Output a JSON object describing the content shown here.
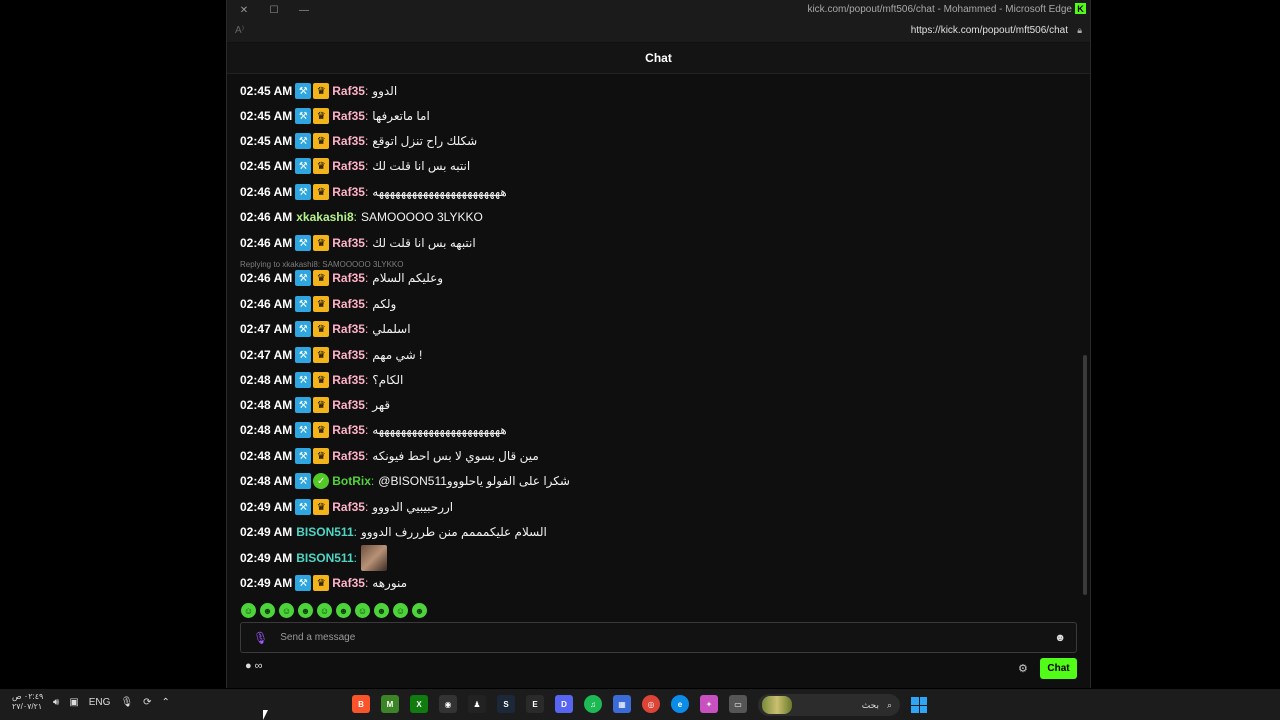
{
  "browser": {
    "title": "kick.com/popout/mft506/chat - Mohammed - Microsoft Edge",
    "url": "https://kick.com/popout/mft506/chat"
  },
  "chat": {
    "header": "Chat",
    "reply_context": "Replying to xkakashi8: SAMOOOOO 3LYKKO",
    "messages": [
      {
        "time": "02:45 AM",
        "user": "Raf35",
        "text": "الدوو",
        "color": "#ffb3c6",
        "badges": [
          "mod",
          "crown"
        ]
      },
      {
        "time": "02:45 AM",
        "user": "Raf35",
        "text": "اما ماتعرفها",
        "color": "#ffb3c6",
        "badges": [
          "mod",
          "crown"
        ]
      },
      {
        "time": "02:45 AM",
        "user": "Raf35",
        "text": "شكلك راح تنزل اتوقع",
        "color": "#ffb3c6",
        "badges": [
          "mod",
          "crown"
        ]
      },
      {
        "time": "02:45 AM",
        "user": "Raf35",
        "text": "انتبه بس انا قلت لك",
        "color": "#ffb3c6",
        "badges": [
          "mod",
          "crown"
        ]
      },
      {
        "time": "02:46 AM",
        "user": "Raf35",
        "text": "هههههههههههههههههههههههه",
        "color": "#ffb3c6",
        "badges": [
          "mod",
          "crown"
        ]
      },
      {
        "time": "02:46 AM",
        "user": "xkakashi8",
        "text": "SAMOOOOO 3LYKKO",
        "color": "#b6f08a",
        "badges": []
      },
      {
        "time": "02:46 AM",
        "user": "Raf35",
        "text": "انتبهه بس انا قلت لك",
        "color": "#ffb3c6",
        "badges": [
          "mod",
          "crown"
        ]
      },
      {
        "time": "02:46 AM",
        "user": "Raf35",
        "text": "وعليكم السلام",
        "color": "#ffb3c6",
        "badges": [
          "mod",
          "crown"
        ]
      },
      {
        "time": "02:46 AM",
        "user": "Raf35",
        "text": "ولكم",
        "color": "#ffb3c6",
        "badges": [
          "mod",
          "crown"
        ]
      },
      {
        "time": "02:47 AM",
        "user": "Raf35",
        "text": "اسلملي",
        "color": "#ffb3c6",
        "badges": [
          "mod",
          "crown"
        ]
      },
      {
        "time": "02:47 AM",
        "user": "Raf35",
        "text": "شي مهم !",
        "color": "#ffb3c6",
        "badges": [
          "mod",
          "crown"
        ]
      },
      {
        "time": "02:48 AM",
        "user": "Raf35",
        "text": "الكام؟",
        "color": "#ffb3c6",
        "badges": [
          "mod",
          "crown"
        ]
      },
      {
        "time": "02:48 AM",
        "user": "Raf35",
        "text": "قهر",
        "color": "#ffb3c6",
        "badges": [
          "mod",
          "crown"
        ]
      },
      {
        "time": "02:48 AM",
        "user": "Raf35",
        "text": "هههههههههههههههههههههههه",
        "color": "#ffb3c6",
        "badges": [
          "mod",
          "crown"
        ]
      },
      {
        "time": "02:48 AM",
        "user": "Raf35",
        "text": "مين قال بسوي لا بس احط فيونكه",
        "color": "#ffb3c6",
        "badges": [
          "mod",
          "crown"
        ]
      },
      {
        "time": "02:48 AM",
        "user": "BotRix",
        "text": "@BISON511شكرا على الفولو ياحلووو",
        "color": "#53d23a",
        "badges": [
          "mod",
          "verified"
        ]
      },
      {
        "time": "02:49 AM",
        "user": "Raf35",
        "text": "اررحبيبيي الدووو",
        "color": "#ffb3c6",
        "badges": [
          "mod",
          "crown"
        ]
      },
      {
        "time": "02:49 AM",
        "user": "BISON511",
        "text": "السلام عليكمممم منن طرررف الدووو",
        "color": "#4ed6c5",
        "badges": []
      },
      {
        "time": "02:49 AM",
        "user": "BISON511",
        "text": "",
        "color": "#4ed6c5",
        "badges": [],
        "emote": true
      },
      {
        "time": "02:49 AM",
        "user": "Raf35",
        "text": "منورهه",
        "color": "#ffb3c6",
        "badges": [
          "mod",
          "crown"
        ]
      }
    ],
    "input_placeholder": "Send a message",
    "chat_button": "Chat",
    "accent": "#53fc18"
  },
  "taskbar": {
    "clock_time": "٠٢:٤٩ ص",
    "clock_date": "٢٧/٠٧/٢١",
    "language": "ENG",
    "search_label": "بحث"
  }
}
